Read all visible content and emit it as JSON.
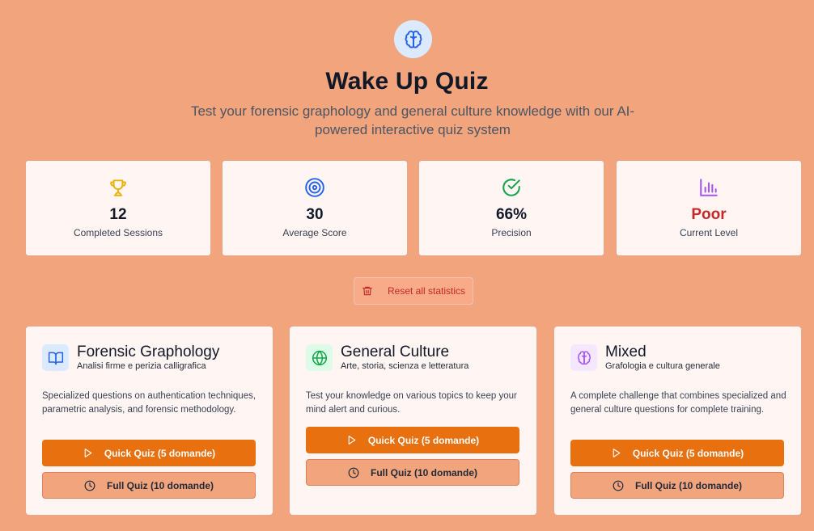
{
  "header": {
    "logo_icon": "brain-icon",
    "title": "Wake Up Quiz",
    "subtitle": "Test your forensic graphology and general culture knowledge with our AI-powered interactive quiz system"
  },
  "stats": [
    {
      "icon": "trophy-icon",
      "value": "12",
      "label": "Completed Sessions",
      "color": "#eab308"
    },
    {
      "icon": "target-icon",
      "value": "30",
      "label": "Average Score",
      "color": "#2563eb"
    },
    {
      "icon": "check-circle-icon",
      "value": "66%",
      "label": "Precision",
      "color": "#16a34a"
    },
    {
      "icon": "bar-chart-icon",
      "value": "Poor",
      "label": "Current Level",
      "color": "#a855f7"
    }
  ],
  "reset_label": "Reset all statistics",
  "cards": [
    {
      "icon": "book-icon",
      "title": "Forensic Graphology",
      "subtitle": "Analisi firme e perizia calligrafica",
      "description": "Specialized questions on authentication techniques, parametric analysis, and forensic methodology.",
      "quick_label": "Quick Quiz (5 domande)",
      "full_label": "Full Quiz (10 domande)"
    },
    {
      "icon": "globe-icon",
      "title": "General Culture",
      "subtitle": "Arte, storia, scienza e letteratura",
      "description": "Test your knowledge on various topics to keep your mind alert and curious.",
      "quick_label": "Quick Quiz (5 domande)",
      "full_label": "Full Quiz (10 domande)"
    },
    {
      "icon": "brain-icon",
      "title": "Mixed",
      "subtitle": "Grafologia e cultura generale",
      "description": "A complete challenge that combines specialized and general culture questions for complete training.",
      "quick_label": "Quick Quiz (5 domande)",
      "full_label": "Full Quiz (10 domande)"
    }
  ],
  "colors": {
    "background": "#f2a47d",
    "primary_button": "#e8700f",
    "danger": "#c62828"
  }
}
